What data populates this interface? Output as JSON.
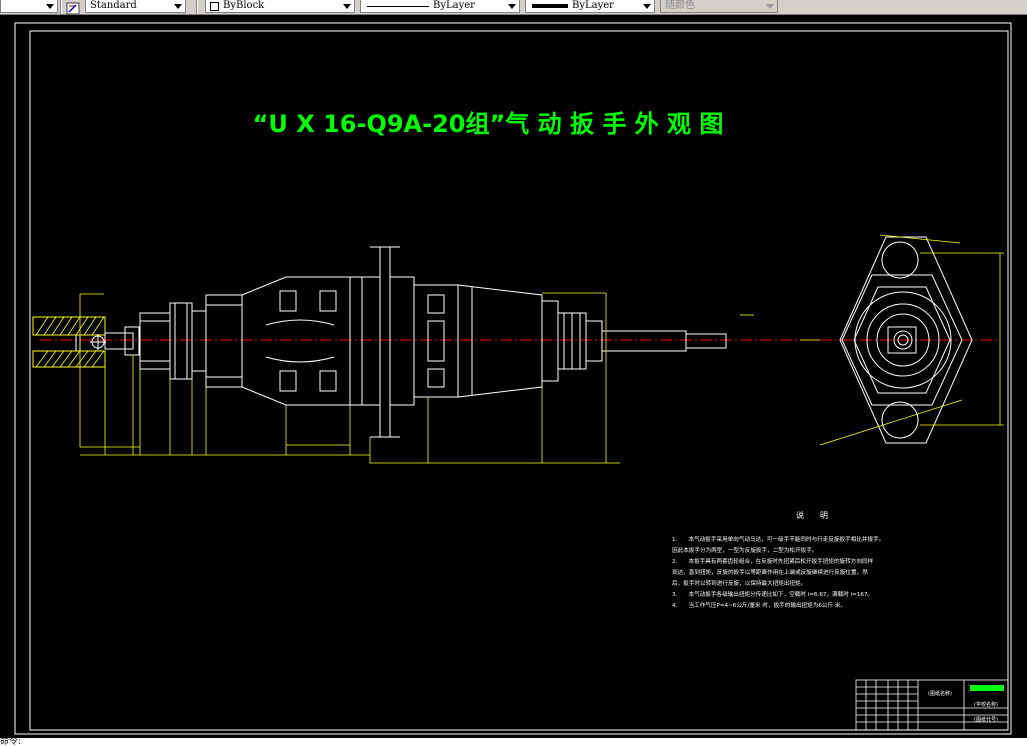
{
  "toolbar": {
    "text_style": "Standard",
    "color": "ByBlock",
    "linetype": "ByLayer",
    "lineweight": "ByLayer",
    "plot_style": "随颜色"
  },
  "drawing": {
    "title": "“U X 16-Q9A-20组”气 动 扳 手 外 观 图",
    "notes_heading": "说　　明",
    "notes": [
      "1.　　本气动扳手采用单向气动马达，可一级手不能同时与行走反旋扳手相比并拔手。",
      "因此本扳手分为两型，一型为反旋扳手，二型为松开扳手。",
      "2.　　本扳手具有两套齿轮组合，在反旋时先扭紧后松开扳手扭矩的旋转方向同样",
      "到达，直到扭矩，反旋的扳手以等距离作用在上端或反旋继续进行反旋位置，然",
      "后，扳手时以转到进行反旋，以保持最大扭矩出扭矩。",
      "3.　　本气动扳手各级输出扭矩分传递比如下，空载时 i=6.67，满载时 i=167。",
      "4.　　当工作气压P=4~6公斤/厘米 时，扳手的输出扭矩为6公斤·米。"
    ],
    "title_block": {
      "drawing_name": "(图纸名称)",
      "school": "(学校名称)",
      "drawing_no": "(图纸代号)"
    }
  },
  "colors": {
    "background": "#000000",
    "drawing_lines": "#ffffff",
    "dimensions": "#ffff00",
    "title_text": "#00ff00",
    "center_line": "#ff0000",
    "frame": "#ffffff"
  },
  "command_line": {
    "text": "命令:"
  }
}
